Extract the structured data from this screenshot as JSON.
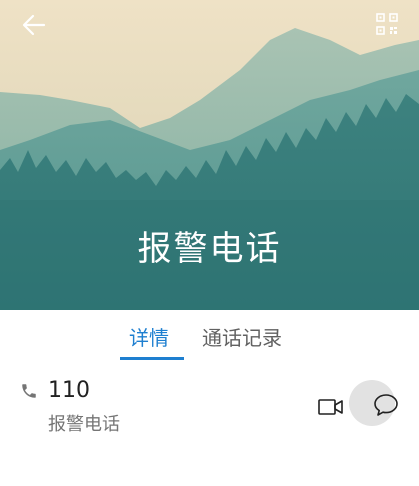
{
  "contact": {
    "name": "报警电话"
  },
  "tabs": [
    {
      "label": "详情",
      "active": true
    },
    {
      "label": "通话记录",
      "active": false
    }
  ],
  "entry": {
    "number": "110",
    "label": "报警电话"
  },
  "colors": {
    "accent": "#1e7fd0",
    "header_teal": "#3f8c8a",
    "sky": "#eadcc0"
  },
  "icons": {
    "back": "arrow-left-icon",
    "qr": "qr-code-icon",
    "phone": "phone-icon",
    "video": "video-call-icon",
    "message": "message-icon"
  }
}
